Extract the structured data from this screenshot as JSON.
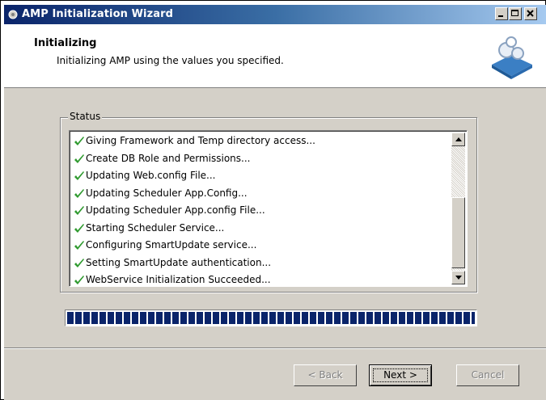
{
  "window": {
    "title": "AMP Initialization Wizard"
  },
  "header": {
    "title": "Initializing",
    "subtitle": "Initializing AMP using the values you specified."
  },
  "status": {
    "group_label": "Status",
    "items": [
      {
        "label": "Giving Framework and Temp directory access..."
      },
      {
        "label": "Create DB Role and Permissions..."
      },
      {
        "label": "Updating Web.config File..."
      },
      {
        "label": "Updating Scheduler App.Config..."
      },
      {
        "label": "Updating Scheduler App.config File..."
      },
      {
        "label": "Starting Scheduler Service..."
      },
      {
        "label": "Configuring SmartUpdate service..."
      },
      {
        "label": "Setting SmartUpdate authentication..."
      },
      {
        "label": "WebService Initialization Succeeded..."
      }
    ]
  },
  "progress": {
    "value": 1.0
  },
  "buttons": {
    "back": "< Back",
    "next": "Next >",
    "cancel": "Cancel"
  },
  "colors": {
    "check": "#2e9a2e",
    "progress": "#0a246a",
    "titlebar": "#0a246a"
  }
}
